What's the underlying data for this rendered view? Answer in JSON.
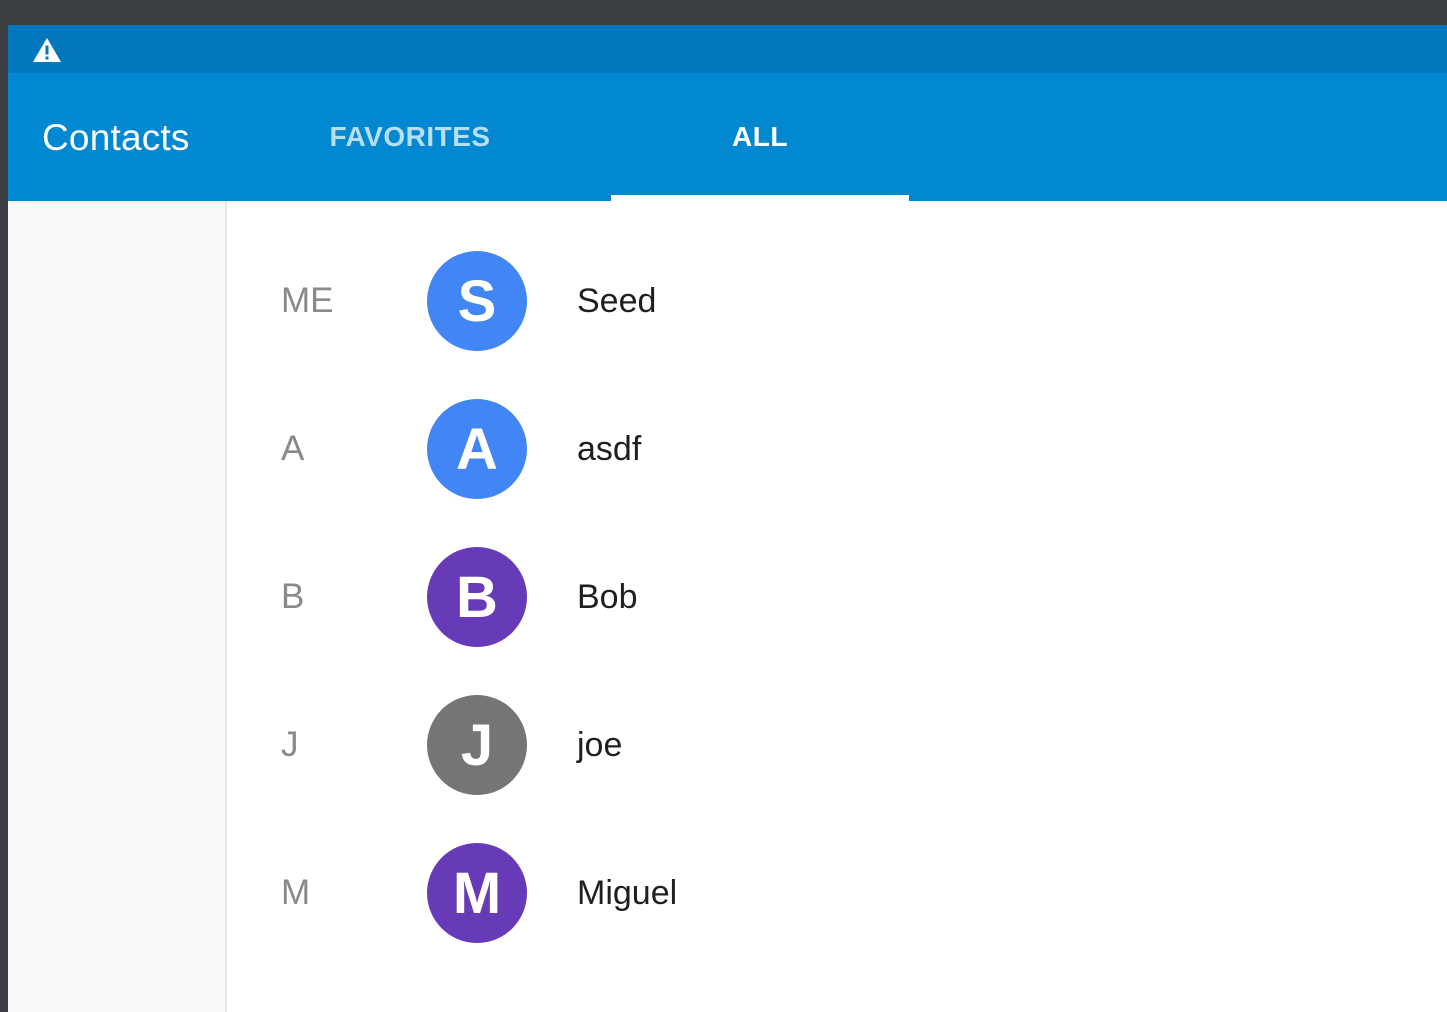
{
  "app": {
    "title": "Contacts"
  },
  "status_bar": {
    "icon": "warning-icon"
  },
  "tabs": [
    {
      "label": "FAVORITES",
      "selected": false
    },
    {
      "label": "ALL",
      "selected": true
    }
  ],
  "colors": {
    "status_bar": "#0277bd",
    "app_bar": "#0288d1",
    "tab_indicator": "#ffffff"
  },
  "contacts": [
    {
      "section": "ME",
      "initial": "S",
      "name": "Seed",
      "avatar_color": "#4285f4"
    },
    {
      "section": "A",
      "initial": "A",
      "name": "asdf",
      "avatar_color": "#4285f4"
    },
    {
      "section": "B",
      "initial": "B",
      "name": "Bob",
      "avatar_color": "#673ab7"
    },
    {
      "section": "J",
      "initial": "J",
      "name": "joe",
      "avatar_color": "#757575"
    },
    {
      "section": "M",
      "initial": "M",
      "name": "Miguel",
      "avatar_color": "#673ab7"
    }
  ]
}
